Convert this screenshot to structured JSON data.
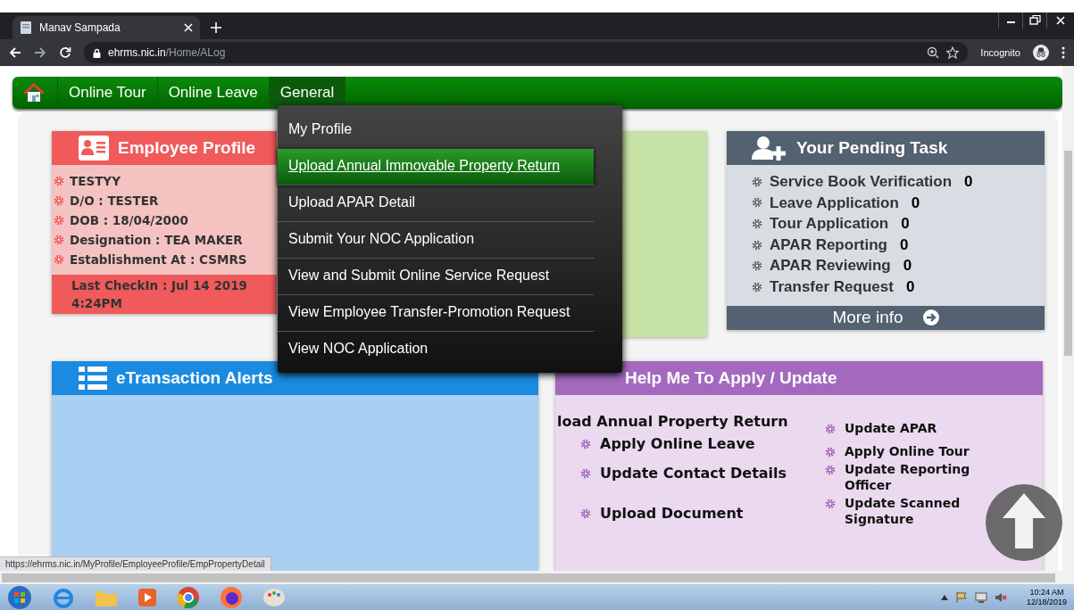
{
  "browser": {
    "tab_title": "Manav Sampada",
    "url_host": "ehrms.nic.in",
    "url_path": "/Home/ALog",
    "profile_label": "Incognito"
  },
  "nav": {
    "items": [
      {
        "label": "Online Tour",
        "selected": false
      },
      {
        "label": "Online Leave",
        "selected": false
      },
      {
        "label": "General",
        "selected": true
      }
    ]
  },
  "general_menu": {
    "items": [
      {
        "label": "My Profile",
        "selected": false
      },
      {
        "label": "Upload Annual Immovable Property Return",
        "selected": true
      },
      {
        "label": "Upload APAR Detail",
        "selected": false
      },
      {
        "label": "Submit Your NOC Application",
        "selected": false
      },
      {
        "label": "View and Submit Online Service Request",
        "selected": false
      },
      {
        "label": "View Employee Transfer-Promotion Request",
        "selected": false
      },
      {
        "label": "View NOC Application",
        "selected": false
      }
    ]
  },
  "employee_profile": {
    "title": "Employee Profile",
    "fields": [
      "TESTYY",
      "D/O :  TESTER",
      "DOB :  18/04/2000",
      "Designation :  TEA MAKER",
      "Establishment At :  CSMRS"
    ],
    "last_checkin": "Last CheckIn :  Jul 14 2019 4:24PM"
  },
  "pending_task": {
    "title": "Your Pending Task",
    "items": [
      {
        "label": "Service Book Verification",
        "count": "0"
      },
      {
        "label": "Leave Application",
        "count": "0"
      },
      {
        "label": "Tour Application",
        "count": "0"
      },
      {
        "label": "APAR Reporting",
        "count": "0"
      },
      {
        "label": "APAR Reviewing",
        "count": "0"
      },
      {
        "label": "Transfer Request",
        "count": "0"
      }
    ],
    "more": "More info"
  },
  "etransaction": {
    "title": "eTransaction Alerts"
  },
  "help": {
    "title": "Help Me To Apply / Update",
    "left": [
      {
        "label": "load Annual Property Return",
        "kind": "plain"
      },
      {
        "label": "Apply Online Leave",
        "kind": "gear"
      },
      {
        "label": "Update Contact Details",
        "kind": "gear"
      },
      {
        "label": "Upload Document",
        "kind": "gear"
      }
    ],
    "right": [
      {
        "label": "Update APAR",
        "kind": "gear"
      },
      {
        "label": "Apply Online Tour",
        "kind": "gear"
      },
      {
        "label": "Update Reporting Officer",
        "kind": "gear"
      },
      {
        "label": "Update Scanned Signature",
        "kind": "gear"
      }
    ]
  },
  "status_bar": {
    "link_preview": "https://ehrms.nic.in/MyProfile/EmployeeProfile/EmpPropertyDetail"
  },
  "taskbar": {
    "time": "10:24 AM",
    "date": "12/18/2019"
  }
}
